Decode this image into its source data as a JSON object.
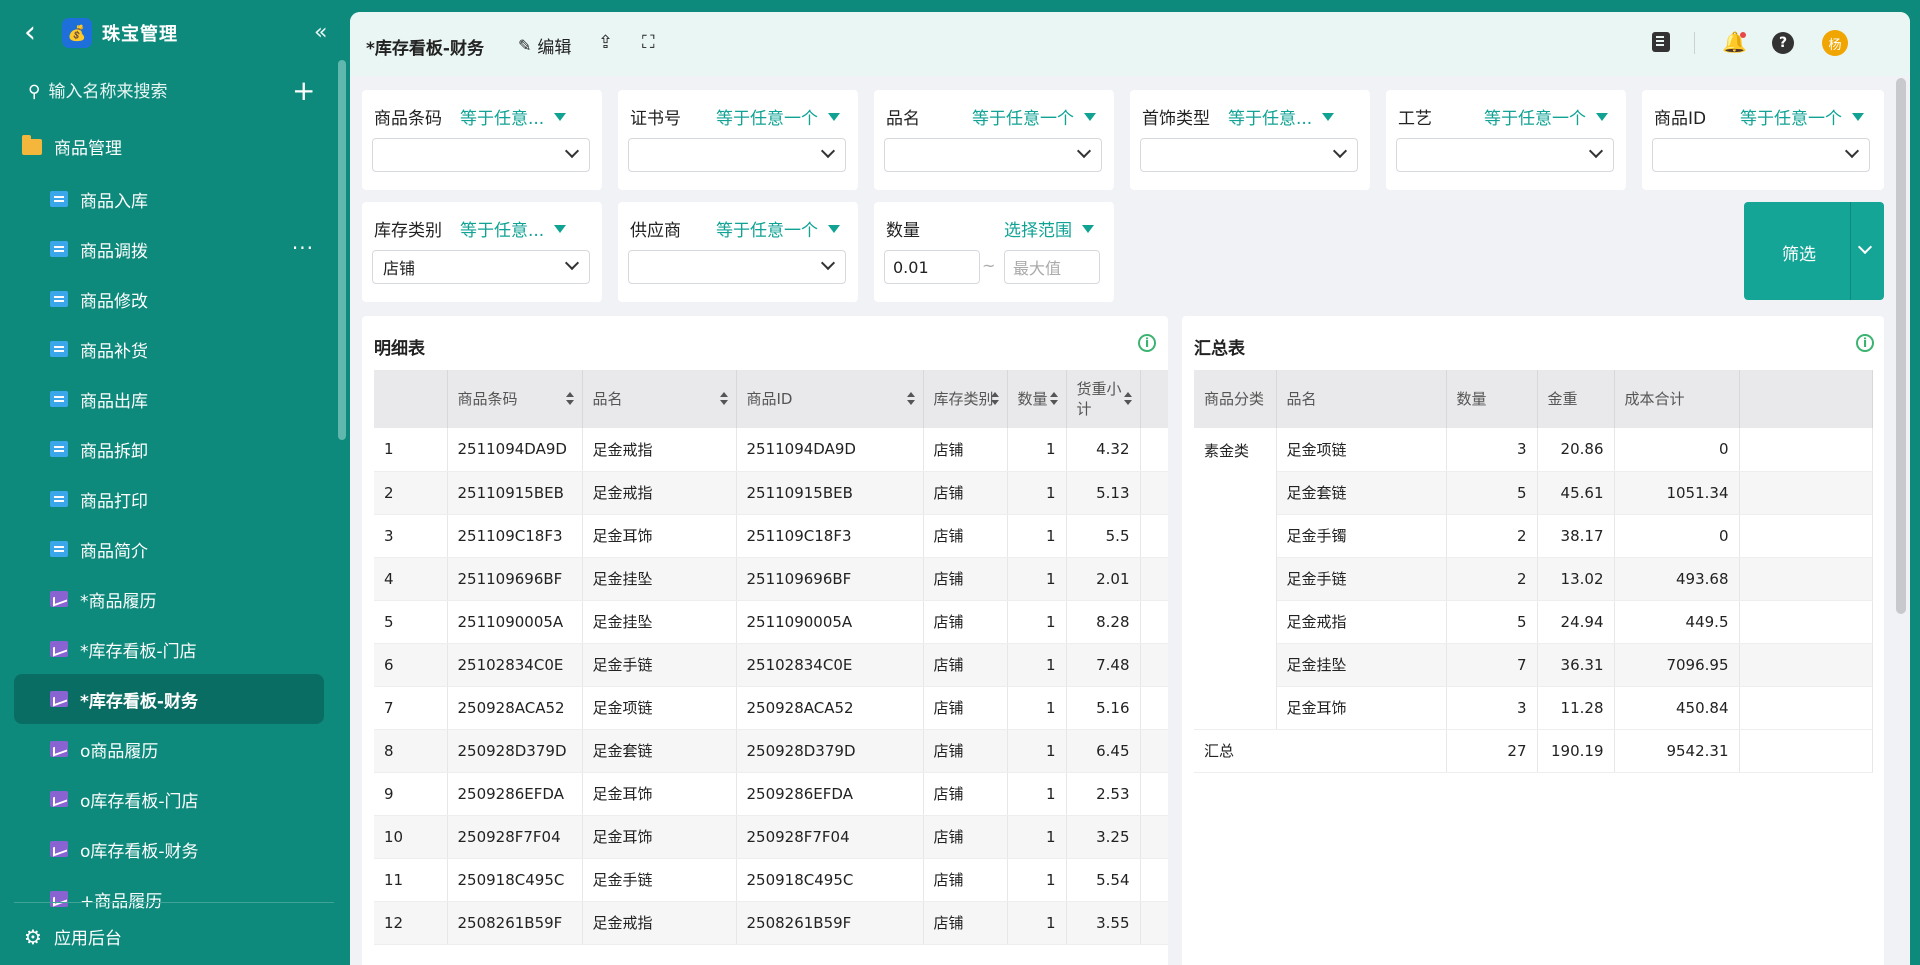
{
  "sidebar": {
    "app_title": "珠宝管理",
    "search_placeholder": "输入名称来搜索",
    "group_label": "商品管理",
    "items": [
      {
        "label": "商品入库",
        "icon": "doc-icon",
        "type": "doc"
      },
      {
        "label": "商品调拨",
        "icon": "doc-icon",
        "type": "doc",
        "more": "···"
      },
      {
        "label": "商品修改",
        "icon": "doc-icon",
        "type": "doc"
      },
      {
        "label": "商品补货",
        "icon": "doc-icon",
        "type": "doc"
      },
      {
        "label": "商品出库",
        "icon": "doc-icon",
        "type": "doc"
      },
      {
        "label": "商品拆卸",
        "icon": "doc-icon",
        "type": "doc"
      },
      {
        "label": "商品打印",
        "icon": "doc-icon",
        "type": "doc"
      },
      {
        "label": "商品简介",
        "icon": "doc-icon",
        "type": "doc"
      },
      {
        "label": "*商品履历",
        "icon": "chart-icon",
        "type": "chart"
      },
      {
        "label": "*库存看板-门店",
        "icon": "chart-icon",
        "type": "chart"
      },
      {
        "label": "*库存看板-财务",
        "icon": "chart-icon",
        "type": "chart",
        "active": true
      },
      {
        "label": "o商品履历",
        "icon": "chart-icon",
        "type": "chart"
      },
      {
        "label": "o库存看板-门店",
        "icon": "chart-icon",
        "type": "chart"
      },
      {
        "label": "o库存看板-财务",
        "icon": "chart-icon",
        "type": "chart"
      },
      {
        "label": "+商品履历",
        "icon": "chart-icon",
        "type": "chart"
      }
    ],
    "footer_label": "应用后台"
  },
  "topbar": {
    "page_title": "*库存看板-财务",
    "edit_label": "编辑",
    "avatar_text": "杨",
    "help_text": "?"
  },
  "filters": {
    "barcode": {
      "label": "商品条码",
      "op": "等于任意..."
    },
    "cert": {
      "label": "证书号",
      "op": "等于任意一个"
    },
    "name": {
      "label": "品名",
      "op": "等于任意一个"
    },
    "jewelry_type": {
      "label": "首饰类型",
      "op": "等于任意..."
    },
    "craft": {
      "label": "工艺",
      "op": "等于任意一个"
    },
    "product_id": {
      "label": "商品ID",
      "op": "等于任意一个"
    },
    "stock_type": {
      "label": "库存类别",
      "op": "等于任意...",
      "value": "店铺"
    },
    "supplier": {
      "label": "供应商",
      "op": "等于任意一个"
    },
    "quantity": {
      "label": "数量",
      "op": "选择范围",
      "min": "0.01",
      "max_placeholder": "最大值",
      "tilde": "~"
    },
    "submit_label": "筛选"
  },
  "detail": {
    "title": "明细表",
    "columns": [
      "",
      "商品条码",
      "品名",
      "商品ID",
      "库存类别",
      "数量",
      "货重小计"
    ],
    "rows": [
      [
        "1",
        "2511094DA9D",
        "足金戒指",
        "2511094DA9D",
        "店铺",
        "1",
        "4.32"
      ],
      [
        "2",
        "25110915BEB",
        "足金戒指",
        "25110915BEB",
        "店铺",
        "1",
        "5.13"
      ],
      [
        "3",
        "251109C18F3",
        "足金耳饰",
        "251109C18F3",
        "店铺",
        "1",
        "5.5"
      ],
      [
        "4",
        "251109696BF",
        "足金挂坠",
        "251109696BF",
        "店铺",
        "1",
        "2.01"
      ],
      [
        "5",
        "2511090005A",
        "足金挂坠",
        "2511090005A",
        "店铺",
        "1",
        "8.28"
      ],
      [
        "6",
        "25102834C0E",
        "足金手链",
        "25102834C0E",
        "店铺",
        "1",
        "7.48"
      ],
      [
        "7",
        "250928ACA52",
        "足金项链",
        "250928ACA52",
        "店铺",
        "1",
        "5.16"
      ],
      [
        "8",
        "250928D379D",
        "足金套链",
        "250928D379D",
        "店铺",
        "1",
        "6.45"
      ],
      [
        "9",
        "2509286EFDA",
        "足金耳饰",
        "2509286EFDA",
        "店铺",
        "1",
        "2.53"
      ],
      [
        "10",
        "250928F7F04",
        "足金耳饰",
        "250928F7F04",
        "店铺",
        "1",
        "3.25"
      ],
      [
        "11",
        "250918C495C",
        "足金手链",
        "250918C495C",
        "店铺",
        "1",
        "5.54"
      ],
      [
        "12",
        "2508261B59F",
        "足金戒指",
        "2508261B59F",
        "店铺",
        "1",
        "3.55"
      ]
    ]
  },
  "summary": {
    "title": "汇总表",
    "columns": [
      "商品分类",
      "品名",
      "数量",
      "金重",
      "成本合计",
      ""
    ],
    "category": "素金类",
    "rows": [
      [
        "足金项链",
        "3",
        "20.86",
        "0"
      ],
      [
        "足金套链",
        "5",
        "45.61",
        "1051.34"
      ],
      [
        "足金手镯",
        "2",
        "38.17",
        "0"
      ],
      [
        "足金手链",
        "2",
        "13.02",
        "493.68"
      ],
      [
        "足金戒指",
        "5",
        "24.94",
        "449.5"
      ],
      [
        "足金挂坠",
        "7",
        "36.31",
        "7096.95"
      ],
      [
        "足金耳饰",
        "3",
        "11.28",
        "450.84"
      ]
    ],
    "total": {
      "label": "汇总",
      "qty": "27",
      "weight": "190.19",
      "cost": "9542.31"
    }
  },
  "colors": {
    "brand": "#0e8a7d",
    "accent": "#14a596",
    "active_item": "#0a6d64"
  }
}
